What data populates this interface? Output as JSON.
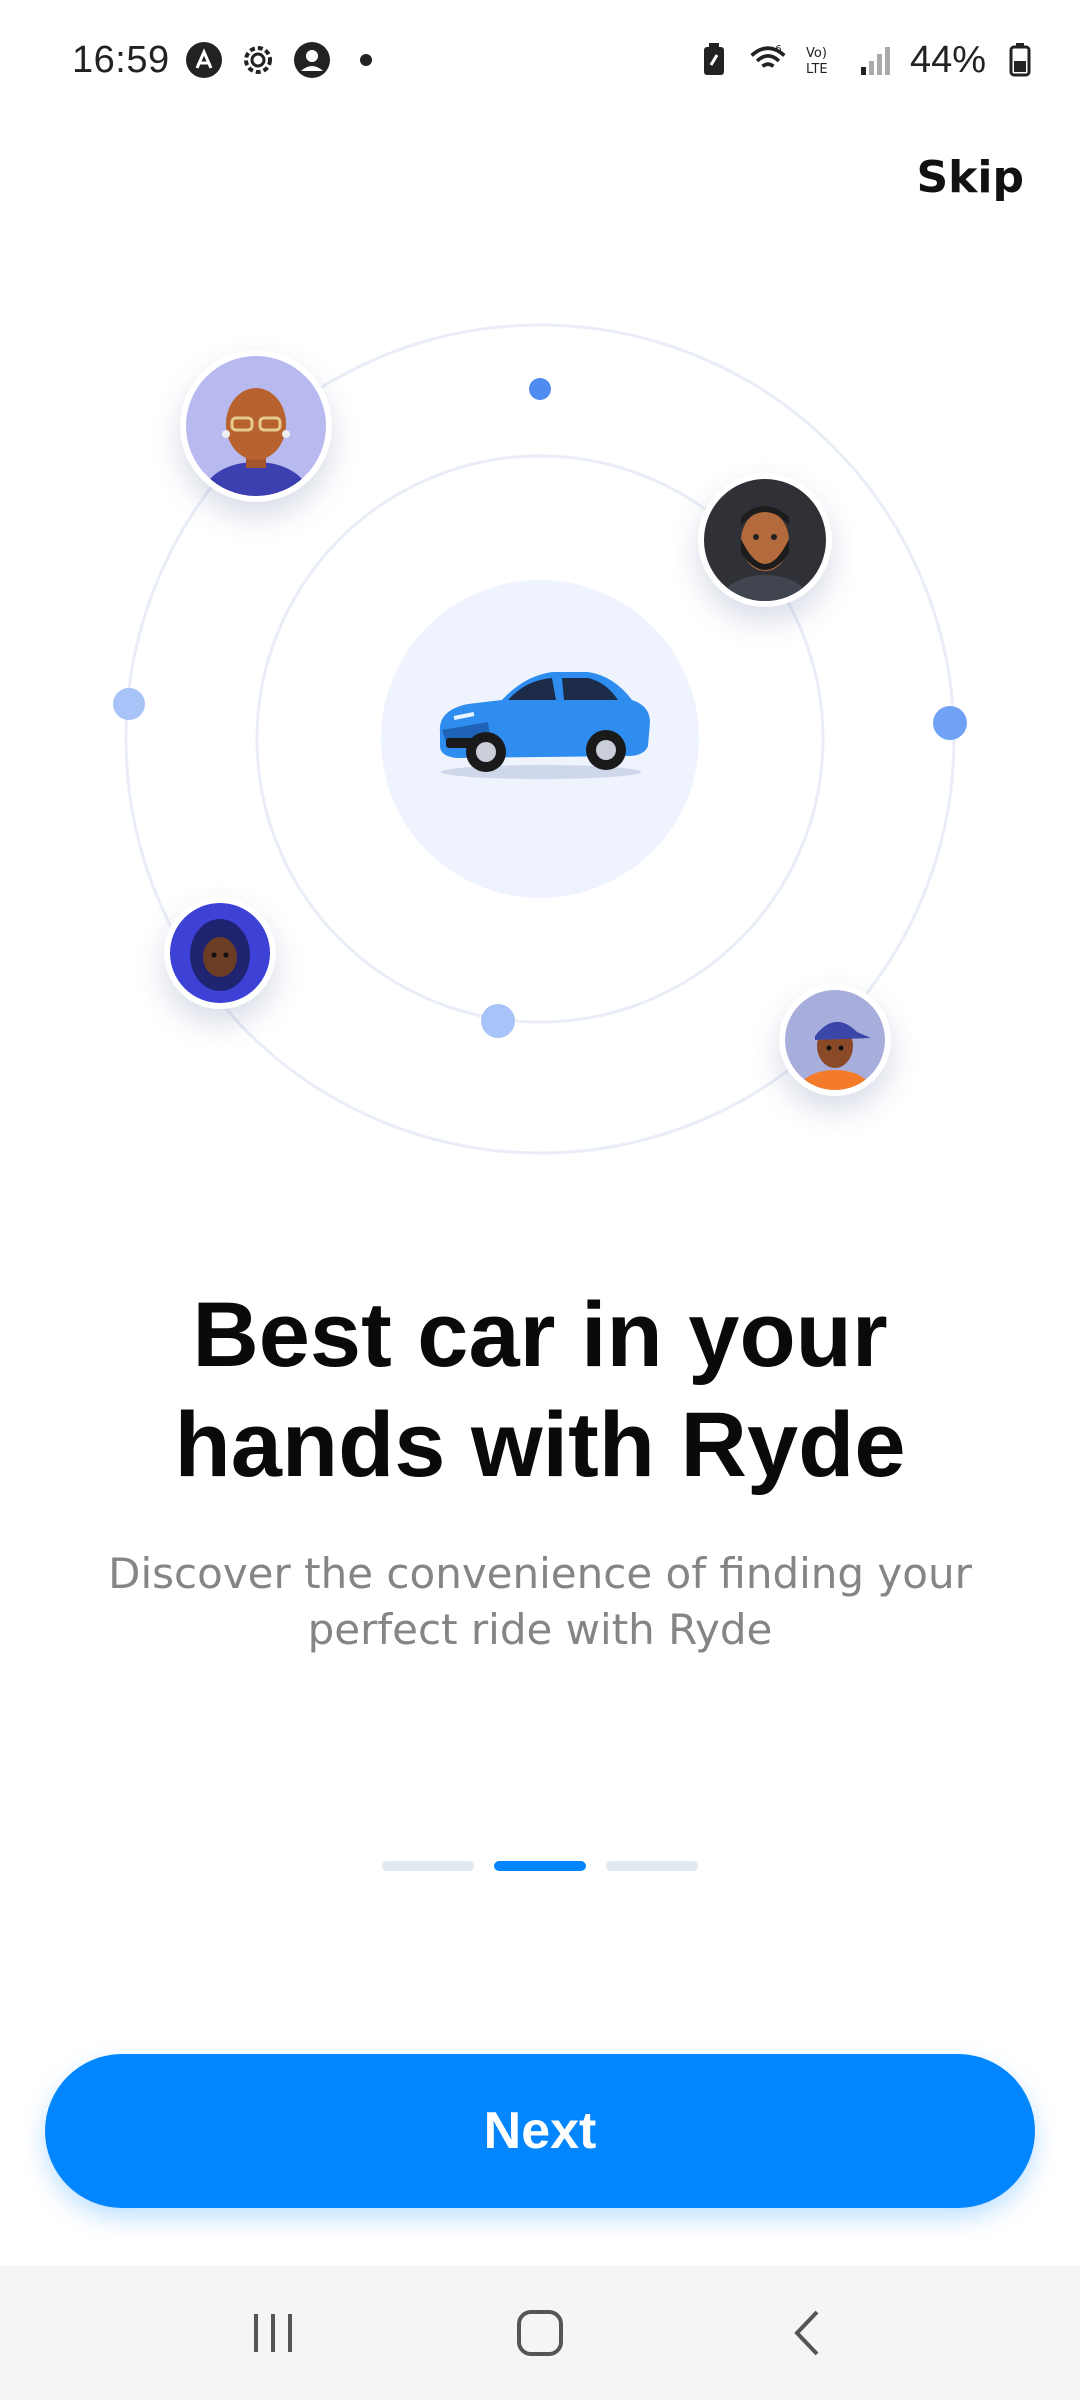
{
  "status_bar": {
    "time": "16:59",
    "battery_percent": "44%",
    "left_icons": [
      "app-a-icon",
      "settings-gear-icon",
      "account-circle-icon",
      "dot-icon"
    ],
    "right_icons": [
      "battery-saver-icon",
      "wifi-6-icon",
      "volte-icon",
      "signal-icon",
      "battery-icon"
    ]
  },
  "header": {
    "skip_label": "Skip"
  },
  "onboarding": {
    "title": "Best car in your hands with Ryde",
    "description": "Discover the convenience of finding your perfect ride with Ryde",
    "current_page": 2,
    "total_pages": 3
  },
  "actions": {
    "next_label": "Next"
  },
  "nav_bar": {
    "items": [
      "recent-apps-icon",
      "home-icon",
      "back-icon"
    ]
  },
  "colors": {
    "primary": "#0286ff",
    "inactive_dash": "#e2e8f0",
    "car_circle": "#eef3fe",
    "orbit_dot": "#4f8cf0"
  }
}
